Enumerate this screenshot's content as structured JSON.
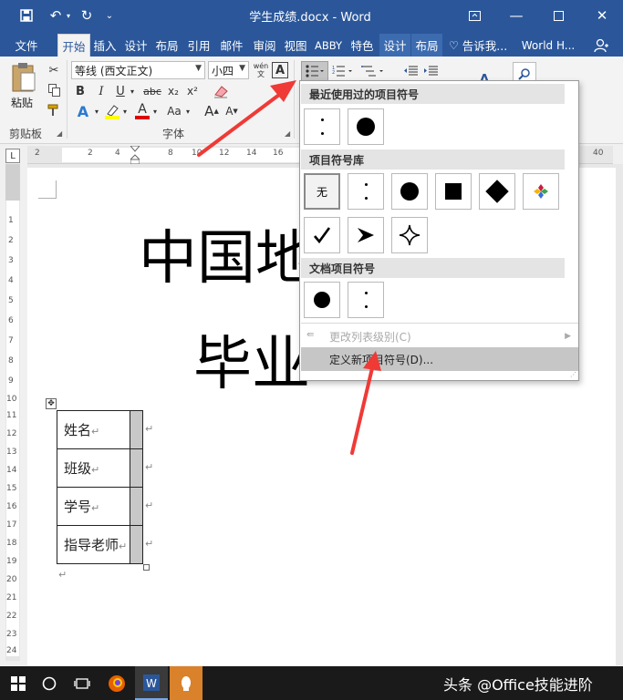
{
  "titlebar": {
    "document_title": "学生成绩.docx - Word"
  },
  "tabs": [
    {
      "label": "文件"
    },
    {
      "label": "开始"
    },
    {
      "label": "插入"
    },
    {
      "label": "设计"
    },
    {
      "label": "布局"
    },
    {
      "label": "引用"
    },
    {
      "label": "邮件"
    },
    {
      "label": "审阅"
    },
    {
      "label": "视图"
    },
    {
      "label": "ABBY"
    },
    {
      "label": "特色"
    },
    {
      "label": "设计"
    },
    {
      "label": "布局"
    }
  ],
  "tell_me": "告诉我...",
  "account_name": "World H...",
  "ribbon": {
    "paste_label": "粘贴",
    "font_name": "等线 (西文正文)",
    "font_size": "小四",
    "phonetic_guide": "wén",
    "bold": "B",
    "italic": "I",
    "underline": "U",
    "strikethrough": "abc",
    "subscript": "x₂",
    "superscript": "x²",
    "font_color_letter": "A",
    "change_case": "Aa",
    "grow_font": "A",
    "shrink_font": "A",
    "clipboard_group": "剪贴板",
    "font_group": "字体"
  },
  "ruler": {
    "h_ticks": [
      "2",
      "2",
      "4",
      "8",
      "10",
      "12",
      "14",
      "16",
      "40"
    ],
    "v_ticks": [
      "1",
      "2",
      "3",
      "4",
      "5",
      "6",
      "7",
      "8",
      "9",
      "10",
      "11",
      "12",
      "13",
      "14",
      "15",
      "16",
      "17",
      "18",
      "19",
      "20",
      "21",
      "22",
      "23",
      "24"
    ]
  },
  "document": {
    "heading_line1": "中国地",
    "heading_line2": "毕业",
    "table_rows": [
      {
        "label": "姓名"
      },
      {
        "label": "班级"
      },
      {
        "label": "学号"
      },
      {
        "label": "指导老师"
      }
    ]
  },
  "bullet_menu": {
    "recent_header": "最近使用过的项目符号",
    "library_header": "项目符号库",
    "document_header": "文档项目符号",
    "none_label": "无",
    "change_level": "更改列表级别(C)",
    "define_new": "定义新项目符号(D)..."
  },
  "watermark": "头条 @Office技能进阶",
  "colors": {
    "word_blue": "#2b579a",
    "arrow_red": "#ef3a36",
    "highlight_yellow": "#ffff00",
    "font_color_red": "#e00000"
  }
}
